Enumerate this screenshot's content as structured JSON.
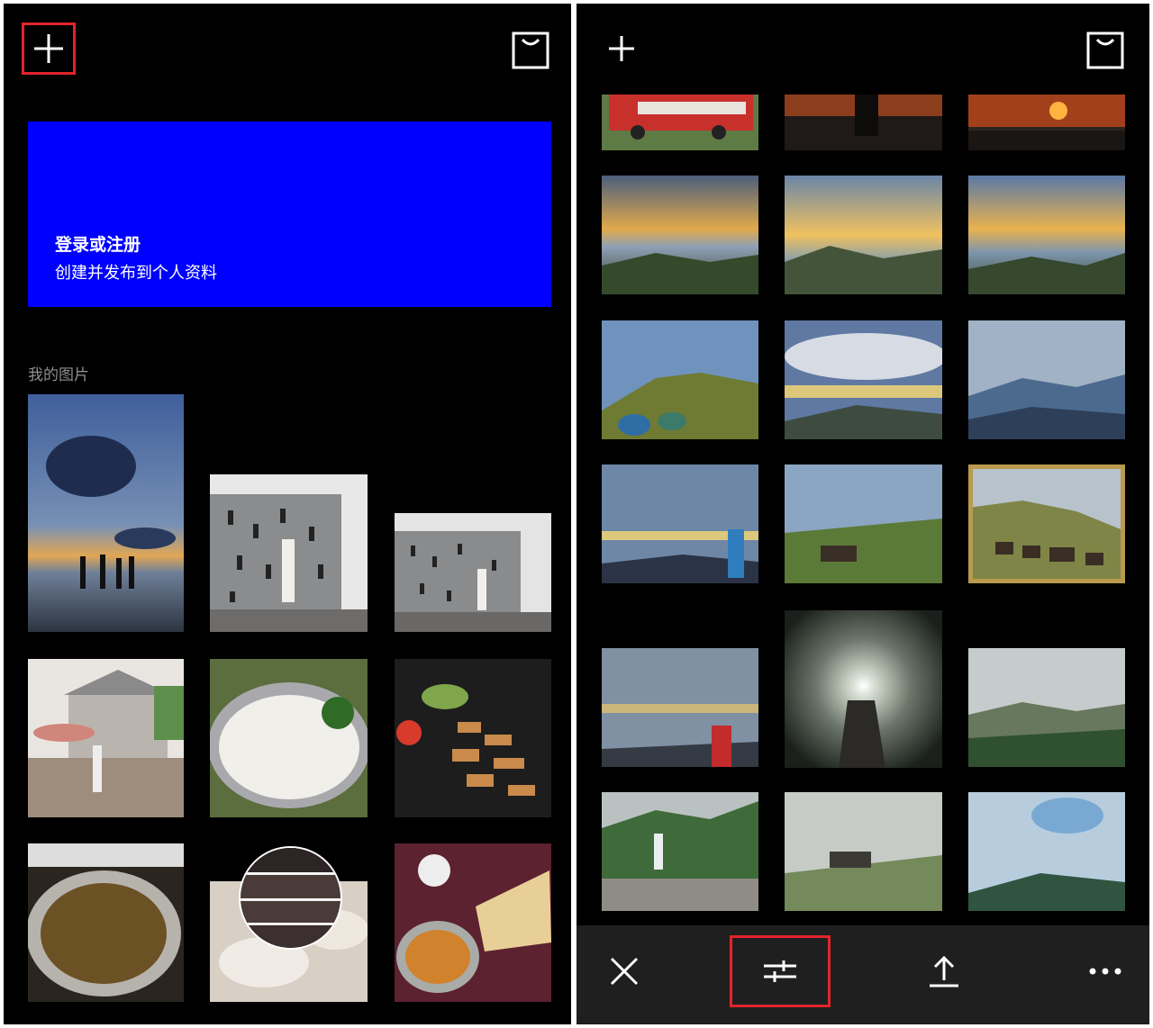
{
  "left_panel": {
    "toolbar": {
      "add_icon": "plus-icon",
      "store_icon": "shopping-bag-icon",
      "highlight_color": "#e3242b"
    },
    "login_card": {
      "title": "登录或注册",
      "subtitle": "创建并发布到个人资料",
      "background_color": "#0000ff"
    },
    "section_label": "我的图片",
    "photos": [
      {
        "name": "sunset-beach-silhouettes"
      },
      {
        "name": "white-outfit-wall-photo"
      },
      {
        "name": "white-outfit-wall-photo-small"
      },
      {
        "name": "pagoda-house-street"
      },
      {
        "name": "rice-plate"
      },
      {
        "name": "grilled-food-plate"
      },
      {
        "name": "curry-bowl"
      },
      {
        "name": "flatbread-with-loading-overlay"
      },
      {
        "name": "curry-and-naan-table"
      }
    ]
  },
  "right_panel": {
    "toolbar": {
      "add_icon": "plus-icon",
      "store_icon": "shopping-bag-icon"
    },
    "photos": [
      {
        "name": "red-bus"
      },
      {
        "name": "dark-sunset-silhouette"
      },
      {
        "name": "orange-sunset"
      },
      {
        "name": "mountain-sunrise-1"
      },
      {
        "name": "tents-on-ridge"
      },
      {
        "name": "mountain-sunrise-2"
      },
      {
        "name": "tents-under-clouds"
      },
      {
        "name": "sea-of-clouds"
      },
      {
        "name": "blue-mountain-ranges"
      },
      {
        "name": "person-blue-jacket"
      },
      {
        "name": "cows-grazing"
      },
      {
        "name": "cows-on-hillside-selected",
        "selected": true
      },
      {
        "name": "person-red-jacket"
      },
      {
        "name": "flashlight-tunnel"
      },
      {
        "name": "green-valley"
      },
      {
        "name": "waterfall-forest"
      },
      {
        "name": "horse-in-fog"
      },
      {
        "name": "misty-hill-tree"
      }
    ],
    "selection_color": "#b99a4f",
    "bottom_bar": {
      "close_icon": "close-icon",
      "adjust_icon": "sliders-icon",
      "export_icon": "upload-icon",
      "more_icon": "more-dots-icon"
    }
  }
}
